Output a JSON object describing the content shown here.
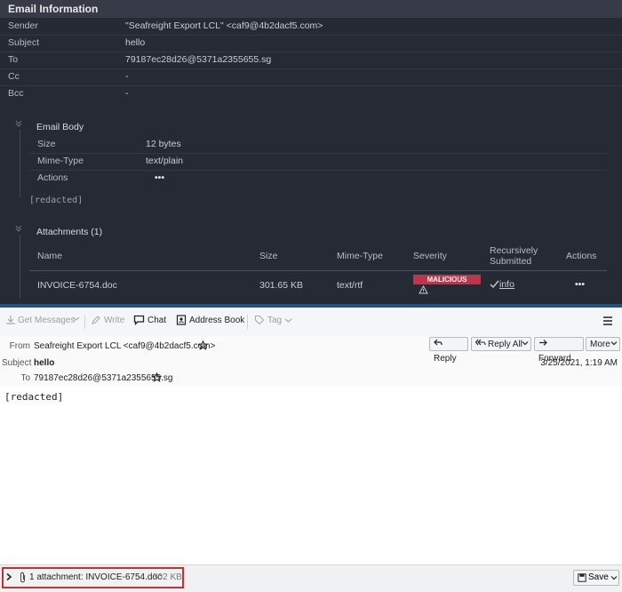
{
  "analysis": {
    "title": "Email Information",
    "fields": [
      {
        "key": "Sender",
        "value": "\"Seafreight Export LCL\" <caf9@4b2dacf5.com>"
      },
      {
        "key": "Subject",
        "value": "hello"
      },
      {
        "key": "To",
        "value": "79187ec28d26@5371a2355655.sg"
      },
      {
        "key": "Cc",
        "value": "-"
      },
      {
        "key": "Bcc",
        "value": "-"
      }
    ],
    "email_body": {
      "title": "Email Body",
      "rows": [
        {
          "key": "Size",
          "value": "12 bytes"
        },
        {
          "key": "Mime-Type",
          "value": "text/plain"
        },
        {
          "key": "Actions",
          "value": "•••"
        }
      ],
      "content": "[redacted]"
    },
    "attachments": {
      "title": "Attachments (1)",
      "columns": [
        "Name",
        "Size",
        "Mime-Type",
        "Severity",
        "Recursively Submitted",
        "Actions"
      ],
      "rows": [
        {
          "name": "INVOICE-6754.doc",
          "size": "301.65 KB",
          "mime": "text/rtf",
          "severity": "MALICIOUS",
          "recursive": "info",
          "actions": "•••"
        }
      ]
    }
  },
  "mail": {
    "toolbar": {
      "get_messages": "Get Messages",
      "write": "Write",
      "chat": "Chat",
      "address_book": "Address Book",
      "tag": "Tag"
    },
    "header": {
      "from_label": "From",
      "from_value": "Seafreight Export LCL <caf9@4b2dacf5.com>",
      "subject_label": "Subject",
      "subject_value": "hello",
      "to_label": "To",
      "to_value": "79187ec28d26@5371a2355655.sg",
      "date": "3/25/2021, 1:19 AM",
      "reply": "Reply",
      "reply_all": "Reply All",
      "forward": "Forward",
      "more": "More"
    },
    "body": "[redacted]",
    "attachment_bar": {
      "label": "1 attachment: INVOICE-6754.doc",
      "size": "302 KB",
      "save": "Save"
    }
  }
}
